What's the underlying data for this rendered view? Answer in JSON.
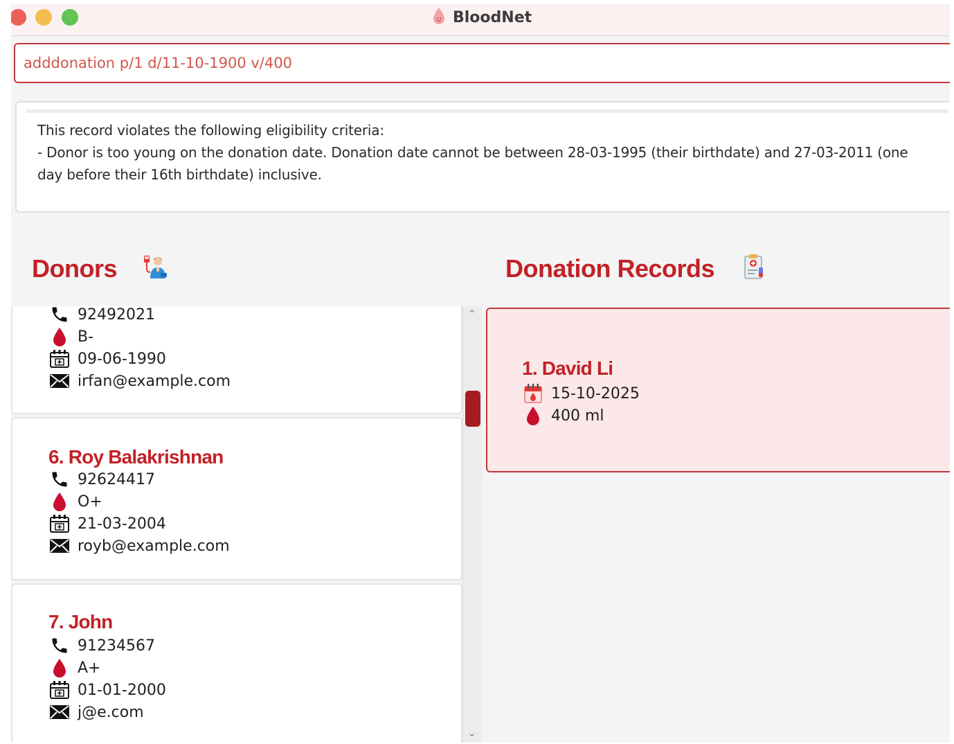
{
  "window": {
    "title": "BloodNet"
  },
  "command": {
    "value": "adddonation p/1 d/11-10-1900 v/400"
  },
  "result": {
    "text": "This record violates the following eligibility criteria:\n- Donor is too young on the donation date. Donation date cannot be between 28-03-1995 (their birthdate) and 27-03-2011 (one day before their 16th birthdate) inclusive."
  },
  "donors": {
    "heading": "Donors",
    "cards": [
      {
        "name": "",
        "phone": "92492021",
        "blood_type": "B-",
        "dob": "09-06-1990",
        "email": "irfan@example.com"
      },
      {
        "name": "6. Roy Balakrishnan",
        "phone": "92624417",
        "blood_type": "O+",
        "dob": "21-03-2004",
        "email": "royb@example.com"
      },
      {
        "name": "7. John",
        "phone": "91234567",
        "blood_type": "A+",
        "dob": "01-01-2000",
        "email": "j@e.com"
      }
    ]
  },
  "records": {
    "heading": "Donation Records",
    "cards": [
      {
        "name": "1. David Li",
        "date": "15-10-2025",
        "volume": "400 ml"
      }
    ]
  },
  "colors": {
    "accent": "#c22127",
    "border_accent": "#c0383a",
    "record_bg": "#fce8e8"
  },
  "icons": [
    "blood-drop-logo-icon",
    "phone-icon",
    "blood-drop-icon",
    "birthday-calendar-icon",
    "email-icon",
    "donor-icon",
    "clipboard-icon",
    "donation-calendar-icon"
  ]
}
